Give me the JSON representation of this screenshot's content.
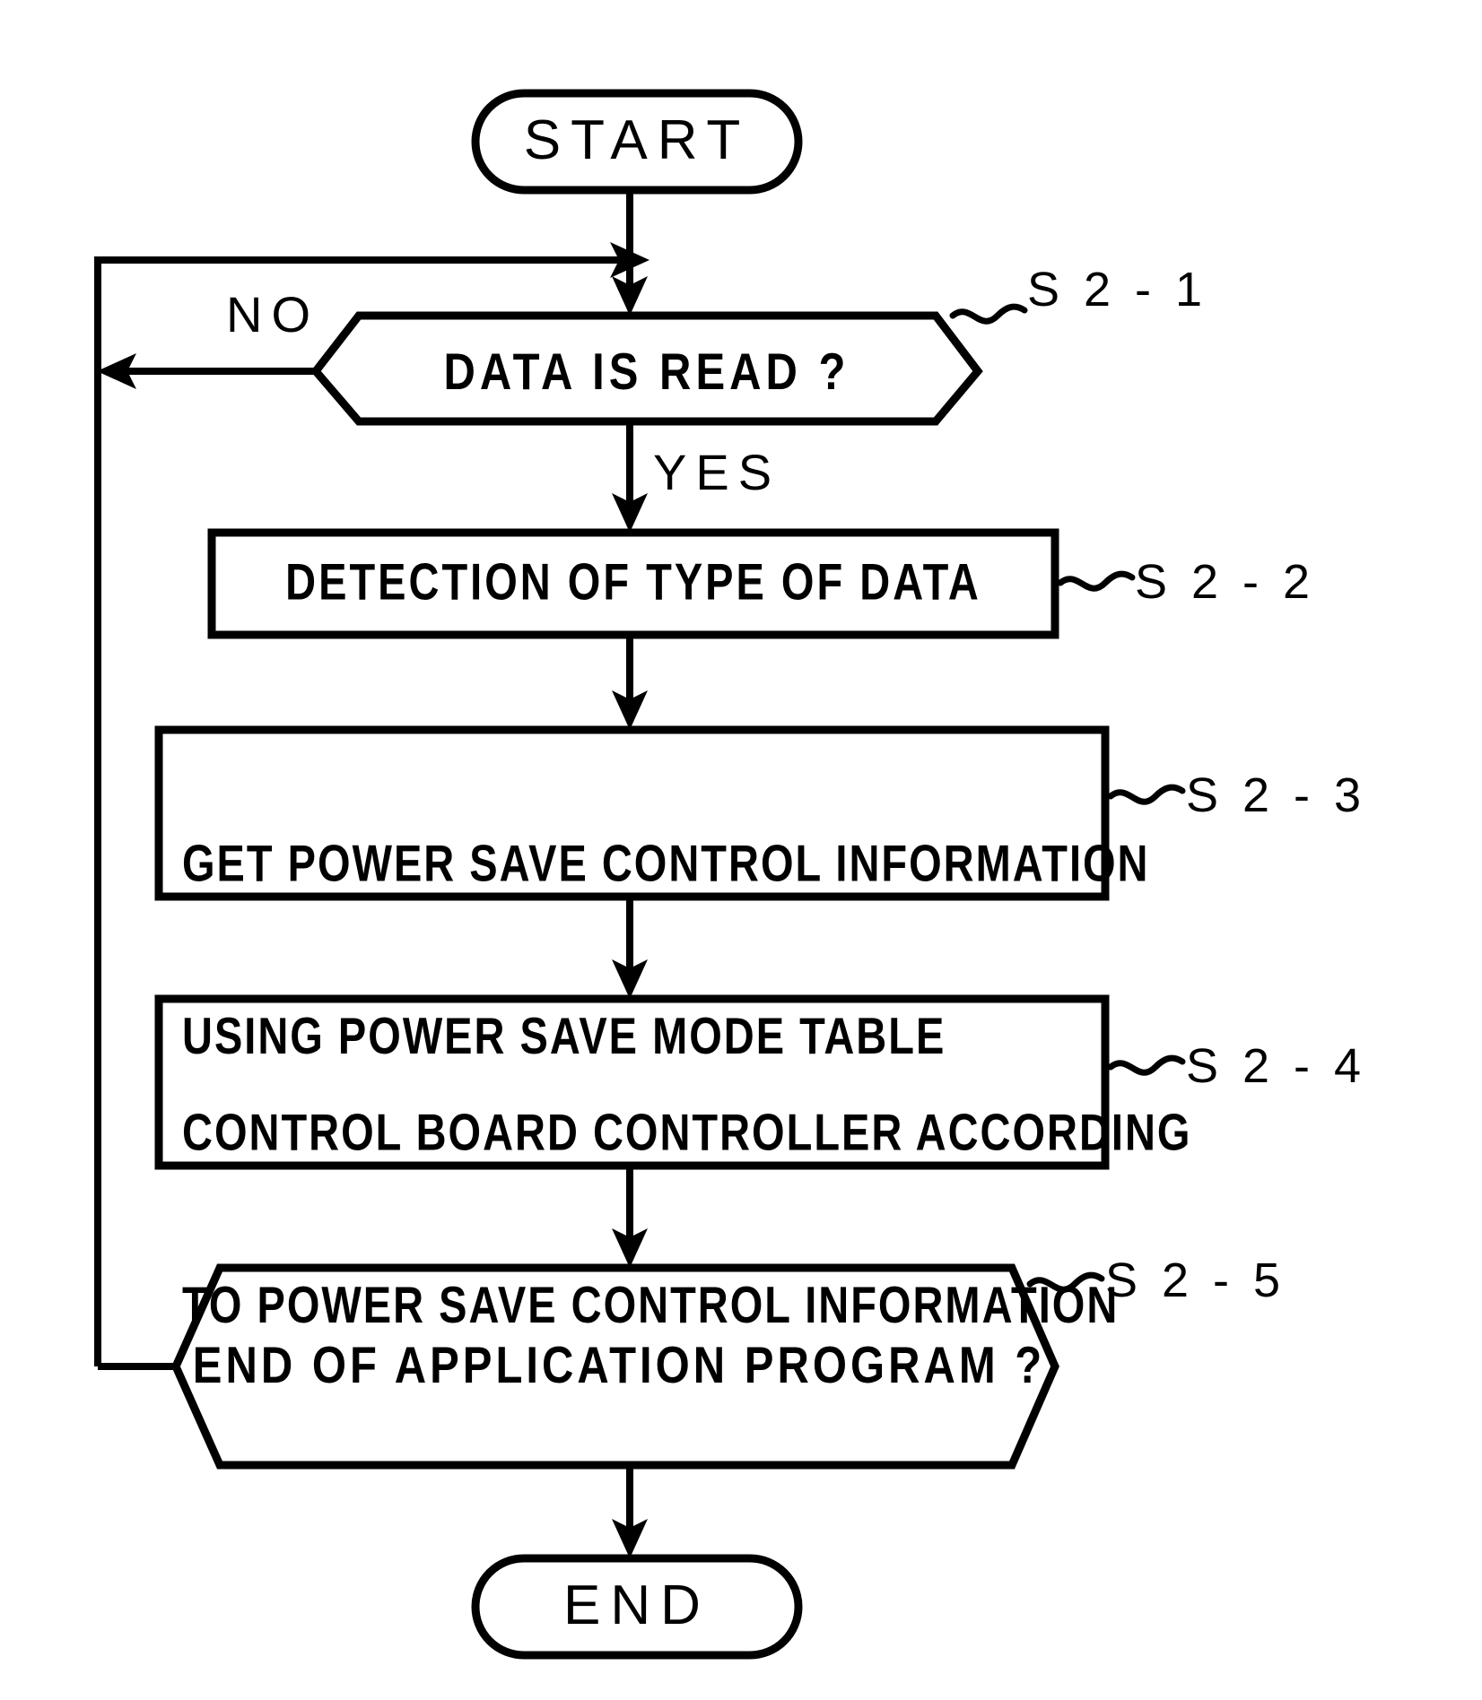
{
  "diagram": {
    "type": "flowchart",
    "title": "",
    "orientation": "vertical",
    "background_color": "#ffffff",
    "line_color": "#000000"
  },
  "nodes": {
    "start": {
      "label": "START",
      "shape": "terminal"
    },
    "decision_read": {
      "label": "DATA IS READ ?",
      "shape": "hexagon",
      "step": "S 2 - 1"
    },
    "branch_no": {
      "label": "NO"
    },
    "branch_yes": {
      "label": "YES"
    },
    "process_detect": {
      "line1": "DETECTION OF TYPE OF DATA",
      "shape": "rectangle",
      "step": "S 2 - 2"
    },
    "process_get": {
      "line1": "GET POWER SAVE CONTROL INFORMATION",
      "line2": "USING POWER SAVE MODE TABLE",
      "shape": "rectangle",
      "step": "S 2 - 3"
    },
    "process_control": {
      "line1": "CONTROL BOARD CONTROLLER ACCORDING",
      "line2": "TO POWER SAVE CONTROL INFORMATION",
      "shape": "rectangle",
      "step": "S 2 - 4"
    },
    "decision_end": {
      "label": "END OF APPLICATION PROGRAM ?",
      "shape": "hexagon",
      "step": "S 2 - 5"
    },
    "end": {
      "label": "END",
      "shape": "terminal"
    }
  },
  "edges": [
    {
      "from": "start",
      "to": "decision_read",
      "label": ""
    },
    {
      "from": "decision_read",
      "to": "process_detect",
      "label": "YES"
    },
    {
      "from": "decision_read",
      "to": "decision_read",
      "label": "NO"
    },
    {
      "from": "process_detect",
      "to": "process_get",
      "label": ""
    },
    {
      "from": "process_get",
      "to": "process_control",
      "label": ""
    },
    {
      "from": "process_control",
      "to": "decision_end",
      "label": ""
    },
    {
      "from": "decision_end",
      "to": "end",
      "label": ""
    },
    {
      "from": "decision_end",
      "to": "decision_read",
      "label": ""
    }
  ]
}
